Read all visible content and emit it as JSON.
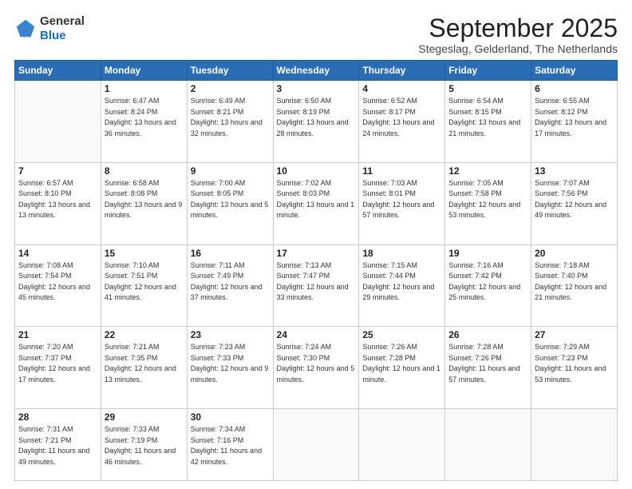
{
  "header": {
    "logo_general": "General",
    "logo_blue": "Blue",
    "month_title": "September 2025",
    "subtitle": "Stegeslag, Gelderland, The Netherlands"
  },
  "days_of_week": [
    "Sunday",
    "Monday",
    "Tuesday",
    "Wednesday",
    "Thursday",
    "Friday",
    "Saturday"
  ],
  "weeks": [
    [
      {
        "day": "",
        "empty": true
      },
      {
        "day": "1",
        "sunrise": "Sunrise: 6:47 AM",
        "sunset": "Sunset: 8:24 PM",
        "daylight": "Daylight: 13 hours and 36 minutes."
      },
      {
        "day": "2",
        "sunrise": "Sunrise: 6:49 AM",
        "sunset": "Sunset: 8:21 PM",
        "daylight": "Daylight: 13 hours and 32 minutes."
      },
      {
        "day": "3",
        "sunrise": "Sunrise: 6:50 AM",
        "sunset": "Sunset: 8:19 PM",
        "daylight": "Daylight: 13 hours and 28 minutes."
      },
      {
        "day": "4",
        "sunrise": "Sunrise: 6:52 AM",
        "sunset": "Sunset: 8:17 PM",
        "daylight": "Daylight: 13 hours and 24 minutes."
      },
      {
        "day": "5",
        "sunrise": "Sunrise: 6:54 AM",
        "sunset": "Sunset: 8:15 PM",
        "daylight": "Daylight: 13 hours and 21 minutes."
      },
      {
        "day": "6",
        "sunrise": "Sunrise: 6:55 AM",
        "sunset": "Sunset: 8:12 PM",
        "daylight": "Daylight: 13 hours and 17 minutes."
      }
    ],
    [
      {
        "day": "7",
        "sunrise": "Sunrise: 6:57 AM",
        "sunset": "Sunset: 8:10 PM",
        "daylight": "Daylight: 13 hours and 13 minutes."
      },
      {
        "day": "8",
        "sunrise": "Sunrise: 6:58 AM",
        "sunset": "Sunset: 8:08 PM",
        "daylight": "Daylight: 13 hours and 9 minutes."
      },
      {
        "day": "9",
        "sunrise": "Sunrise: 7:00 AM",
        "sunset": "Sunset: 8:05 PM",
        "daylight": "Daylight: 13 hours and 5 minutes."
      },
      {
        "day": "10",
        "sunrise": "Sunrise: 7:02 AM",
        "sunset": "Sunset: 8:03 PM",
        "daylight": "Daylight: 13 hours and 1 minute."
      },
      {
        "day": "11",
        "sunrise": "Sunrise: 7:03 AM",
        "sunset": "Sunset: 8:01 PM",
        "daylight": "Daylight: 12 hours and 57 minutes."
      },
      {
        "day": "12",
        "sunrise": "Sunrise: 7:05 AM",
        "sunset": "Sunset: 7:58 PM",
        "daylight": "Daylight: 12 hours and 53 minutes."
      },
      {
        "day": "13",
        "sunrise": "Sunrise: 7:07 AM",
        "sunset": "Sunset: 7:56 PM",
        "daylight": "Daylight: 12 hours and 49 minutes."
      }
    ],
    [
      {
        "day": "14",
        "sunrise": "Sunrise: 7:08 AM",
        "sunset": "Sunset: 7:54 PM",
        "daylight": "Daylight: 12 hours and 45 minutes."
      },
      {
        "day": "15",
        "sunrise": "Sunrise: 7:10 AM",
        "sunset": "Sunset: 7:51 PM",
        "daylight": "Daylight: 12 hours and 41 minutes."
      },
      {
        "day": "16",
        "sunrise": "Sunrise: 7:11 AM",
        "sunset": "Sunset: 7:49 PM",
        "daylight": "Daylight: 12 hours and 37 minutes."
      },
      {
        "day": "17",
        "sunrise": "Sunrise: 7:13 AM",
        "sunset": "Sunset: 7:47 PM",
        "daylight": "Daylight: 12 hours and 33 minutes."
      },
      {
        "day": "18",
        "sunrise": "Sunrise: 7:15 AM",
        "sunset": "Sunset: 7:44 PM",
        "daylight": "Daylight: 12 hours and 29 minutes."
      },
      {
        "day": "19",
        "sunrise": "Sunrise: 7:16 AM",
        "sunset": "Sunset: 7:42 PM",
        "daylight": "Daylight: 12 hours and 25 minutes."
      },
      {
        "day": "20",
        "sunrise": "Sunrise: 7:18 AM",
        "sunset": "Sunset: 7:40 PM",
        "daylight": "Daylight: 12 hours and 21 minutes."
      }
    ],
    [
      {
        "day": "21",
        "sunrise": "Sunrise: 7:20 AM",
        "sunset": "Sunset: 7:37 PM",
        "daylight": "Daylight: 12 hours and 17 minutes."
      },
      {
        "day": "22",
        "sunrise": "Sunrise: 7:21 AM",
        "sunset": "Sunset: 7:35 PM",
        "daylight": "Daylight: 12 hours and 13 minutes."
      },
      {
        "day": "23",
        "sunrise": "Sunrise: 7:23 AM",
        "sunset": "Sunset: 7:33 PM",
        "daylight": "Daylight: 12 hours and 9 minutes."
      },
      {
        "day": "24",
        "sunrise": "Sunrise: 7:24 AM",
        "sunset": "Sunset: 7:30 PM",
        "daylight": "Daylight: 12 hours and 5 minutes."
      },
      {
        "day": "25",
        "sunrise": "Sunrise: 7:26 AM",
        "sunset": "Sunset: 7:28 PM",
        "daylight": "Daylight: 12 hours and 1 minute."
      },
      {
        "day": "26",
        "sunrise": "Sunrise: 7:28 AM",
        "sunset": "Sunset: 7:26 PM",
        "daylight": "Daylight: 11 hours and 57 minutes."
      },
      {
        "day": "27",
        "sunrise": "Sunrise: 7:29 AM",
        "sunset": "Sunset: 7:23 PM",
        "daylight": "Daylight: 11 hours and 53 minutes."
      }
    ],
    [
      {
        "day": "28",
        "sunrise": "Sunrise: 7:31 AM",
        "sunset": "Sunset: 7:21 PM",
        "daylight": "Daylight: 11 hours and 49 minutes."
      },
      {
        "day": "29",
        "sunrise": "Sunrise: 7:33 AM",
        "sunset": "Sunset: 7:19 PM",
        "daylight": "Daylight: 11 hours and 46 minutes."
      },
      {
        "day": "30",
        "sunrise": "Sunrise: 7:34 AM",
        "sunset": "Sunset: 7:16 PM",
        "daylight": "Daylight: 11 hours and 42 minutes."
      },
      {
        "day": "",
        "empty": true
      },
      {
        "day": "",
        "empty": true
      },
      {
        "day": "",
        "empty": true
      },
      {
        "day": "",
        "empty": true
      }
    ]
  ]
}
